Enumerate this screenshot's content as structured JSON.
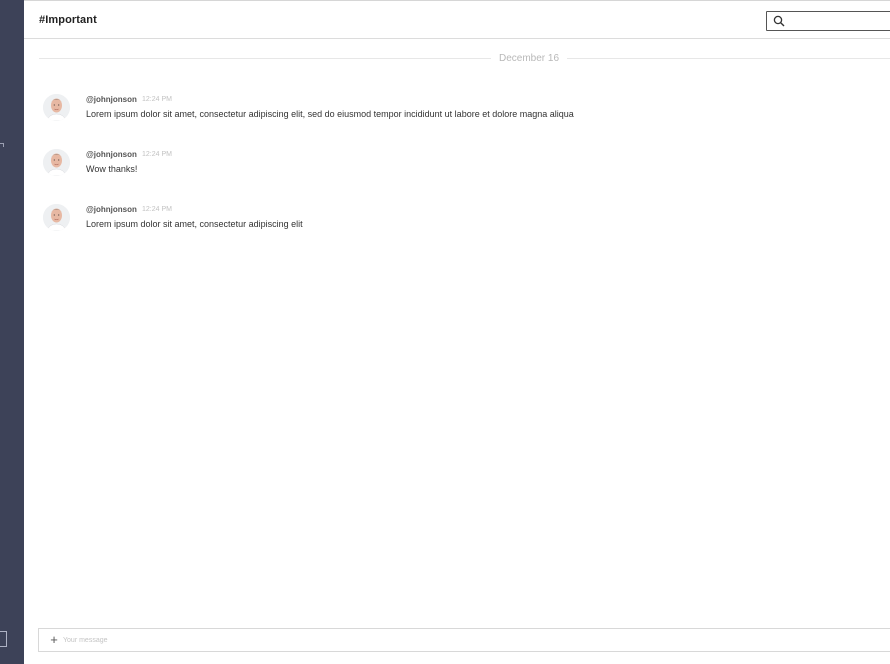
{
  "channel": {
    "title": "#Important"
  },
  "search": {
    "placeholder": ""
  },
  "divider": {
    "date": "December 16"
  },
  "messages": [
    {
      "author": "@johnjonson",
      "time": "12:24 PM",
      "text": "Lorem ipsum dolor sit amet, consectetur adipiscing elit, sed do eiusmod tempor incididunt ut labore et dolore magna aliqua"
    },
    {
      "author": "@johnjonson",
      "time": "12:24 PM",
      "text": "Wow thanks!"
    },
    {
      "author": "@johnjonson",
      "time": "12:24 PM",
      "text": "Lorem ipsum dolor sit amet, consectetur adipiscing elit"
    }
  ],
  "composer": {
    "placeholder": "Your message",
    "add_icon": "plus-icon"
  },
  "colors": {
    "sidebar": "#3d4258",
    "border": "#dcdcdc",
    "text": "#333333",
    "muted": "#b8b8b8"
  }
}
